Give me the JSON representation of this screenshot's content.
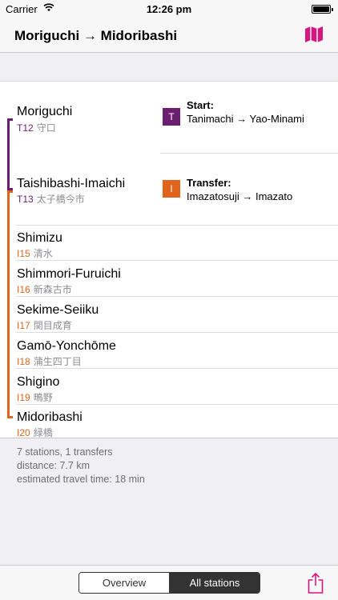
{
  "status_bar": {
    "carrier": "Carrier",
    "time": "12:26 pm"
  },
  "nav": {
    "title": "Moriguchi → Midoribashi"
  },
  "colors": {
    "purple": "#6b1d6f",
    "orange": "#e1641c",
    "map_icon": "#d6177e",
    "share_icon": "#d6177e"
  },
  "stations": [
    {
      "name": "Moriguchi",
      "code": "T12",
      "kanji": "守口",
      "line": "purple"
    },
    {
      "name": "Taishibashi-Imaichi",
      "code": "T13",
      "kanji": "太子橋今市",
      "line": "purple"
    },
    {
      "name": "Shimizu",
      "code": "I15",
      "kanji": "清水",
      "line": "orange"
    },
    {
      "name": "Shimmori-Furuichi",
      "code": "I16",
      "kanji": "新森古市",
      "line": "orange"
    },
    {
      "name": "Sekime-Seiiku",
      "code": "I17",
      "kanji": "関目成育",
      "line": "orange"
    },
    {
      "name": "Gamō-Yonchōme",
      "code": "I18",
      "kanji": "蒲生四丁目",
      "line": "orange"
    },
    {
      "name": "Shigino",
      "code": "I19",
      "kanji": "鴫野",
      "line": "orange"
    },
    {
      "name": "Midoribashi",
      "code": "I20",
      "kanji": "緑橋",
      "line": "orange"
    }
  ],
  "notes": {
    "start": {
      "badge": "T",
      "title": "Start:",
      "text": "Tanimachi → Yao-Minami"
    },
    "transfer": {
      "badge": "I",
      "title": "Transfer:",
      "text": "Imazatosuji → Imazato"
    }
  },
  "summary": {
    "stations": "7 stations, 1 transfers",
    "distance": "distance: 7.7 km",
    "time": "estimated travel time: 18 min"
  },
  "toolbar": {
    "overview_label": "Overview",
    "all_stations_label": "All stations"
  }
}
